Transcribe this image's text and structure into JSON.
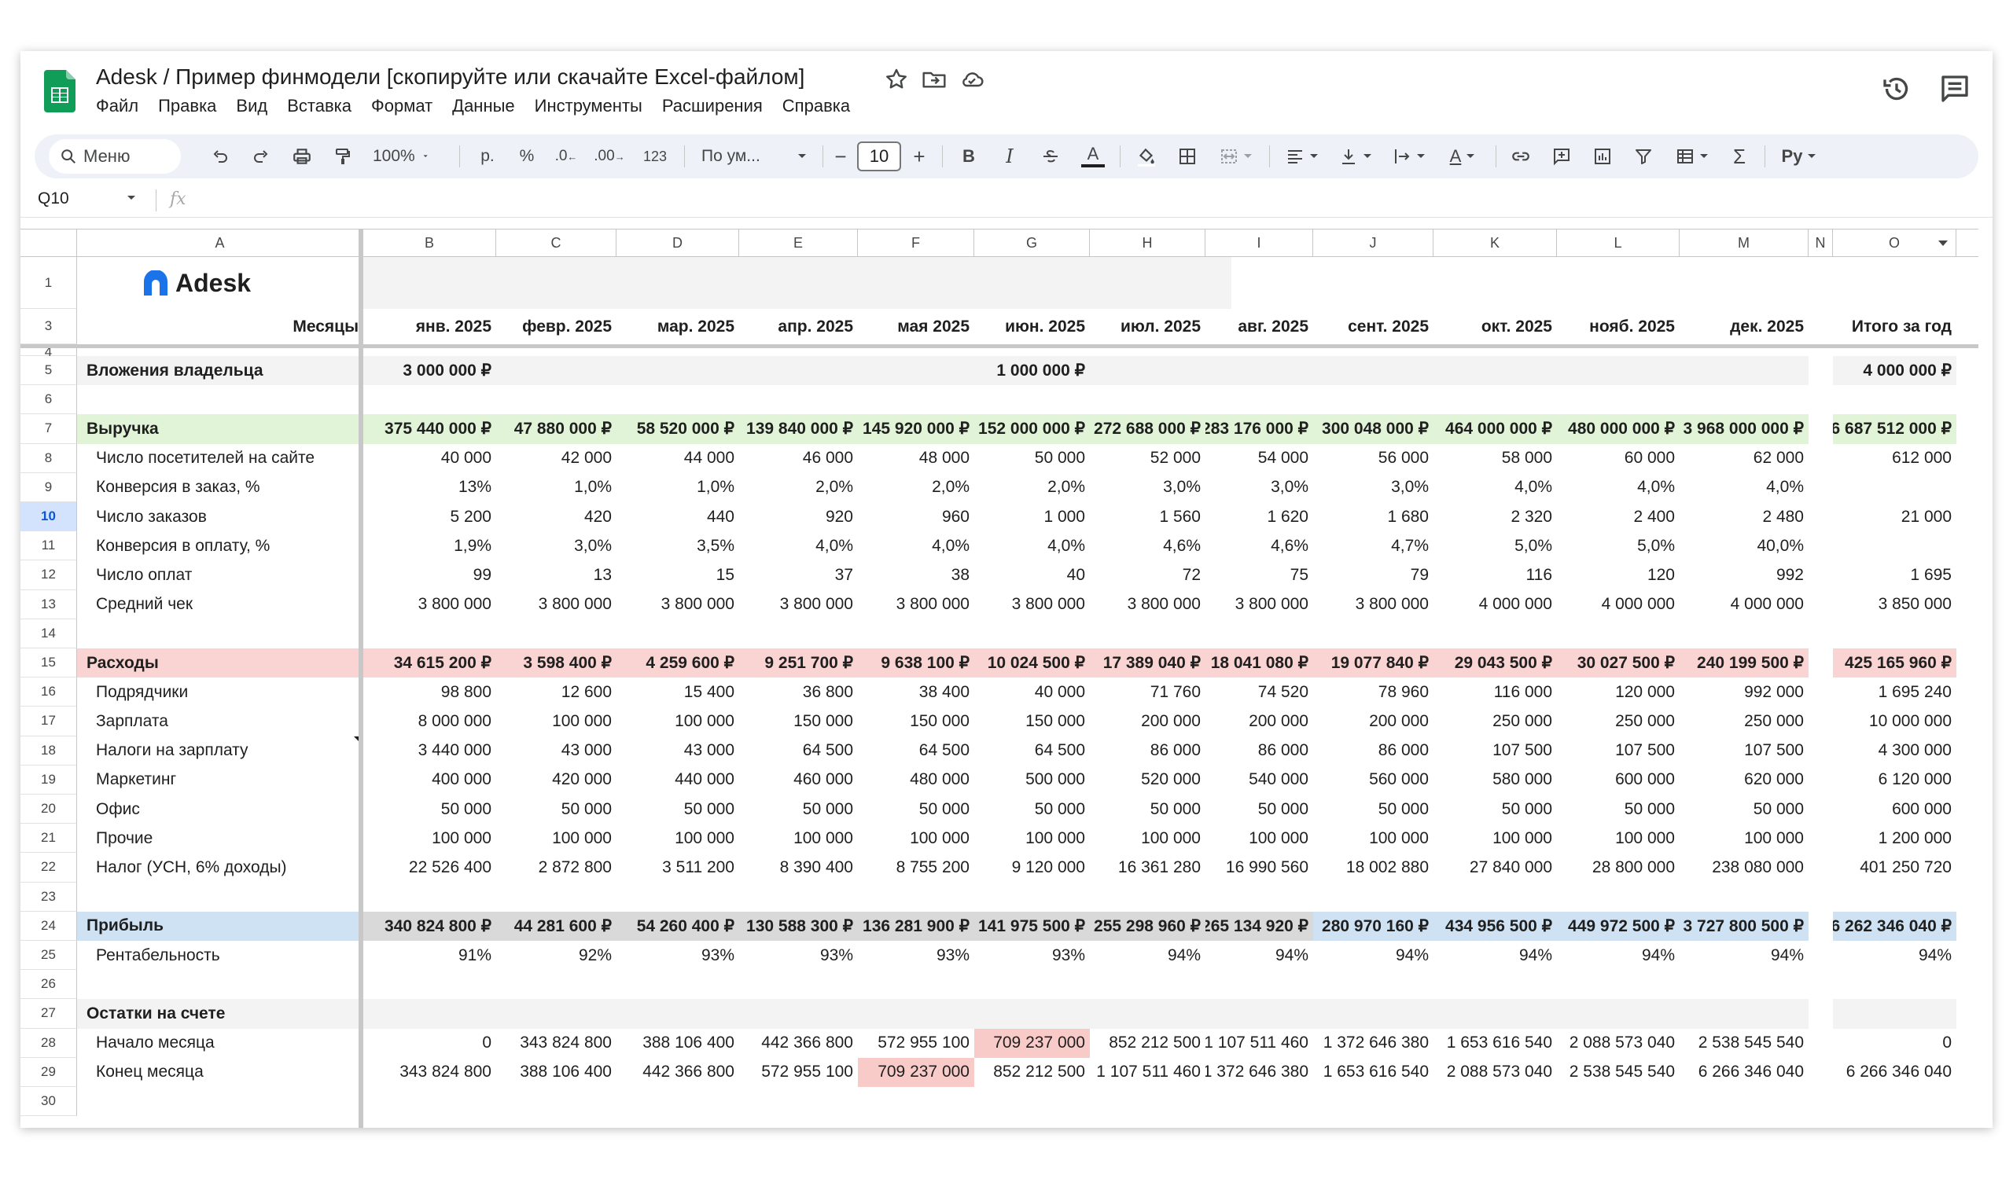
{
  "window": {
    "title": "Adesk /  Пример финмодели [скопируйте или скачайте Excel-файлом]",
    "menu": [
      "Файл",
      "Правка",
      "Вид",
      "Вставка",
      "Формат",
      "Данные",
      "Инструменты",
      "Расширения",
      "Справка"
    ]
  },
  "toolbar": {
    "search_label": "Меню",
    "zoom": "100%",
    "currency": "р.",
    "percent": "%",
    "dec_less": ".0",
    "dec_more": ".00",
    "format_123": "123",
    "font": "По ум...",
    "font_size": "10",
    "minus": "−",
    "plus": "+"
  },
  "formula_bar": {
    "cell_ref": "Q10",
    "fx": "fx",
    "value": ""
  },
  "columns": [
    "A",
    "B",
    "C",
    "D",
    "E",
    "F",
    "G",
    "H",
    "I",
    "J",
    "K",
    "L",
    "M",
    "N",
    "O"
  ],
  "logo_text": "Adesk",
  "colors": {
    "revenue_bg": "#e2f4d8",
    "expenses_bg": "#f9d4d2",
    "profit_bg": "#cfe2f3",
    "profit_gray_bg": "#d9d9d9",
    "highlight_pink": "#f8cbc9",
    "band_gray": "#f3f3f3",
    "selected_row": "#d3e3fd",
    "sheets_green": "#0f9d58"
  },
  "rows": [
    {
      "n": "1",
      "kind": "logo"
    },
    {
      "n": "3",
      "kind": "header",
      "label": "Месяцы",
      "values": [
        "янв. 2025",
        "февр. 2025",
        "мар. 2025",
        "апр. 2025",
        "мая 2025",
        "июн. 2025",
        "июл. 2025",
        "авг. 2025",
        "сент. 2025",
        "окт. 2025",
        "нояб. 2025",
        "дек. 2025",
        "",
        "Итого за год"
      ]
    },
    {
      "n": "4",
      "kind": "blank"
    },
    {
      "n": "5",
      "kind": "section",
      "label": "Вложения владельца",
      "values": [
        "3 000 000 ₽",
        "",
        "",
        "",
        "",
        "1 000 000 ₽",
        "",
        "",
        "",
        "",
        "",
        "",
        "",
        "4 000 000 ₽"
      ]
    },
    {
      "n": "6",
      "kind": "blank"
    },
    {
      "n": "7",
      "kind": "revenue",
      "label": "Выручка",
      "values": [
        "375 440 000 ₽",
        "47 880 000 ₽",
        "58 520 000 ₽",
        "139 840 000 ₽",
        "145 920 000 ₽",
        "152 000 000 ₽",
        "272 688 000 ₽",
        "283 176 000 ₽",
        "300 048 000 ₽",
        "464 000 000 ₽",
        "480 000 000 ₽",
        "3 968 000 000 ₽",
        "",
        "6 687 512 000 ₽"
      ]
    },
    {
      "n": "8",
      "kind": "item",
      "label": "Число посетителей на сайте",
      "values": [
        "40 000",
        "42 000",
        "44 000",
        "46 000",
        "48 000",
        "50 000",
        "52 000",
        "54 000",
        "56 000",
        "58 000",
        "60 000",
        "62 000",
        "",
        "612 000"
      ]
    },
    {
      "n": "9",
      "kind": "item",
      "label": "Конверсия в заказ, %",
      "values": [
        "13%",
        "1,0%",
        "1,0%",
        "2,0%",
        "2,0%",
        "2,0%",
        "3,0%",
        "3,0%",
        "3,0%",
        "4,0%",
        "4,0%",
        "4,0%",
        "",
        ""
      ]
    },
    {
      "n": "10",
      "kind": "item",
      "label": "Число заказов",
      "selected": true,
      "values": [
        "5 200",
        "420",
        "440",
        "920",
        "960",
        "1 000",
        "1 560",
        "1 620",
        "1 680",
        "2 320",
        "2 400",
        "2 480",
        "",
        "21 000"
      ]
    },
    {
      "n": "11",
      "kind": "item",
      "label": "Конверсия в оплату, %",
      "values": [
        "1,9%",
        "3,0%",
        "3,5%",
        "4,0%",
        "4,0%",
        "4,0%",
        "4,6%",
        "4,6%",
        "4,7%",
        "5,0%",
        "5,0%",
        "40,0%",
        "",
        ""
      ]
    },
    {
      "n": "12",
      "kind": "item",
      "label": "Число оплат",
      "values": [
        "99",
        "13",
        "15",
        "37",
        "38",
        "40",
        "72",
        "75",
        "79",
        "116",
        "120",
        "992",
        "",
        "1 695"
      ]
    },
    {
      "n": "13",
      "kind": "item",
      "label": "Средний чек",
      "values": [
        "3 800 000",
        "3 800 000",
        "3 800 000",
        "3 800 000",
        "3 800 000",
        "3 800 000",
        "3 800 000",
        "3 800 000",
        "3 800 000",
        "4 000 000",
        "4 000 000",
        "4 000 000",
        "",
        "3 850 000"
      ]
    },
    {
      "n": "14",
      "kind": "blank"
    },
    {
      "n": "15",
      "kind": "expenses",
      "label": "Расходы",
      "values": [
        "34 615 200 ₽",
        "3 598 400 ₽",
        "4 259 600 ₽",
        "9 251 700 ₽",
        "9 638 100 ₽",
        "10 024 500 ₽",
        "17 389 040 ₽",
        "18 041 080 ₽",
        "19 077 840 ₽",
        "29 043 500 ₽",
        "30 027 500 ₽",
        "240 199 500 ₽",
        "",
        "425 165 960 ₽"
      ]
    },
    {
      "n": "16",
      "kind": "item",
      "label": "Подрядчики",
      "values": [
        "98 800",
        "12 600",
        "15 400",
        "36 800",
        "38 400",
        "40 000",
        "71 760",
        "74 520",
        "78 960",
        "116 000",
        "120 000",
        "992 000",
        "",
        "1 695 240"
      ]
    },
    {
      "n": "17",
      "kind": "item",
      "label": "Зарплата",
      "values": [
        "8 000 000",
        "100 000",
        "100 000",
        "150 000",
        "150 000",
        "150 000",
        "200 000",
        "200 000",
        "200 000",
        "250 000",
        "250 000",
        "250 000",
        "",
        "10 000 000"
      ]
    },
    {
      "n": "18",
      "kind": "item",
      "label": "Налоги на зарплату",
      "note": true,
      "values": [
        "3 440 000",
        "43 000",
        "43 000",
        "64 500",
        "64 500",
        "64 500",
        "86 000",
        "86 000",
        "86 000",
        "107 500",
        "107 500",
        "107 500",
        "",
        "4 300 000"
      ]
    },
    {
      "n": "19",
      "kind": "item",
      "label": "Маркетинг",
      "values": [
        "400 000",
        "420 000",
        "440 000",
        "460 000",
        "480 000",
        "500 000",
        "520 000",
        "540 000",
        "560 000",
        "580 000",
        "600 000",
        "620 000",
        "",
        "6 120 000"
      ]
    },
    {
      "n": "20",
      "kind": "item",
      "label": "Офис",
      "values": [
        "50 000",
        "50 000",
        "50 000",
        "50 000",
        "50 000",
        "50 000",
        "50 000",
        "50 000",
        "50 000",
        "50 000",
        "50 000",
        "50 000",
        "",
        "600 000"
      ]
    },
    {
      "n": "21",
      "kind": "item",
      "label": "Прочие",
      "values": [
        "100 000",
        "100 000",
        "100 000",
        "100 000",
        "100 000",
        "100 000",
        "100 000",
        "100 000",
        "100 000",
        "100 000",
        "100 000",
        "100 000",
        "",
        "1 200 000"
      ]
    },
    {
      "n": "22",
      "kind": "item",
      "label": "Налог (УСН, 6% доходы)",
      "values": [
        "22 526 400",
        "2 872 800",
        "3 511 200",
        "8 390 400",
        "8 755 200",
        "9 120 000",
        "16 361 280",
        "16 990 560",
        "18 002 880",
        "27 840 000",
        "28 800 000",
        "238 080 000",
        "",
        "401 250 720"
      ]
    },
    {
      "n": "23",
      "kind": "blank"
    },
    {
      "n": "24",
      "kind": "profit",
      "label": "Прибыль",
      "values": [
        "340 824 800 ₽",
        "44 281 600 ₽",
        "54 260 400 ₽",
        "130 588 300 ₽",
        "136 281 900 ₽",
        "141 975 500 ₽",
        "255 298 960 ₽",
        "265 134 920 ₽",
        "280 970 160 ₽",
        "434 956 500 ₽",
        "449 972 500 ₽",
        "3 727 800 500 ₽",
        "",
        "6 262 346 040 ₽"
      ]
    },
    {
      "n": "25",
      "kind": "item",
      "label": "Рентабельность",
      "values": [
        "91%",
        "92%",
        "93%",
        "93%",
        "93%",
        "93%",
        "94%",
        "94%",
        "94%",
        "94%",
        "94%",
        "94%",
        "",
        "94%"
      ]
    },
    {
      "n": "26",
      "kind": "blank"
    },
    {
      "n": "27",
      "kind": "section",
      "label": "Остатки на счете",
      "values": [
        "",
        "",
        "",
        "",
        "",
        "",
        "",
        "",
        "",
        "",
        "",
        "",
        "",
        ""
      ]
    },
    {
      "n": "28",
      "kind": "item",
      "label": "Начало месяца",
      "values": [
        "0",
        "343 824 800",
        "388 106 400",
        "442 366 800",
        "572 955 100",
        "709 237 000",
        "852 212 500",
        "1 107 511 460",
        "1 372 646 380",
        "1 653 616 540",
        "2 088 573 040",
        "2 538 545 540",
        "",
        "0"
      ]
    },
    {
      "n": "29",
      "kind": "item",
      "label": "Конец месяца",
      "values": [
        "343 824 800",
        "388 106 400",
        "442 366 800",
        "572 955 100",
        "709 237 000",
        "852 212 500",
        "1 107 511 460",
        "1 372 646 380",
        "1 653 616 540",
        "2 088 573 040",
        "2 538 545 540",
        "6 266 346 040",
        "",
        "6 266 346 040"
      ]
    },
    {
      "n": "30",
      "kind": "blank"
    }
  ]
}
